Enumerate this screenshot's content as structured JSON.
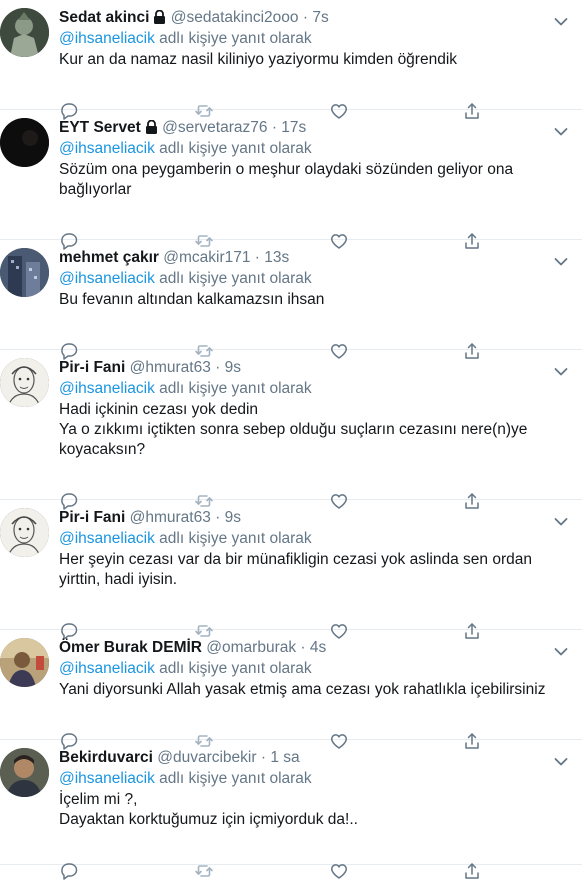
{
  "reply_prefix": "@ihsaneliacik",
  "reply_suffix": " adlı kişiye yanıt olarak",
  "tweets": [
    {
      "name": "Sedat akinci",
      "locked": true,
      "handle": "@sedatakinci2ooo",
      "time": "7s",
      "text": [
        "Kur an da namaz nasil kiliniyo yaziyormu kimden öğrendik"
      ],
      "avatar": "warrior-avatar"
    },
    {
      "name": "EYT Servet",
      "locked": true,
      "handle": "@servetaraz76",
      "time": "17s",
      "text": [
        "Sözüm ona peygamberin o meşhur olaydaki sözünden geliyor ona",
        "bağlıyorlar"
      ],
      "avatar": "dark-avatar"
    },
    {
      "name": "mehmet çakır",
      "locked": false,
      "handle": "@mcakir171",
      "time": "13s",
      "text": [
        "Bu fevanın altından kalkamazsın ihsan"
      ],
      "avatar": "building-avatar"
    },
    {
      "name": "Pir-i Fani",
      "locked": false,
      "handle": "@hmurat63",
      "time": "9s",
      "text": [
        "Hadi içkinin cezası yok dedin",
        "Ya o zıkkımı içtikten sonra sebep olduğu suçların cezasını nere(n)ye",
        "koyacaksın?"
      ],
      "avatar": "sketch-avatar"
    },
    {
      "name": "Pir-i Fani",
      "locked": false,
      "handle": "@hmurat63",
      "time": "9s",
      "text": [
        "Her şeyin cezası var da bir münafikligin cezasi yok aslinda sen ordan",
        "yirttin, hadi iyisin."
      ],
      "avatar": "sketch-avatar"
    },
    {
      "name": "Ömer Burak DEMİR",
      "locked": false,
      "handle": "@omarburak",
      "time": "4s",
      "text": [
        "Yani diyorsunki Allah yasak etmiş ama cezası yok rahatlıkla içebilirsiniz"
      ],
      "avatar": "photo-avatar"
    },
    {
      "name": "Bekirduvarci",
      "locked": false,
      "handle": "@duvarcibekir",
      "time": "1 sa",
      "text": [
        "İçelim mi ?,",
        "Dayaktan korktuğumuz için içmiyorduk da!.."
      ],
      "avatar": "man-avatar"
    }
  ]
}
